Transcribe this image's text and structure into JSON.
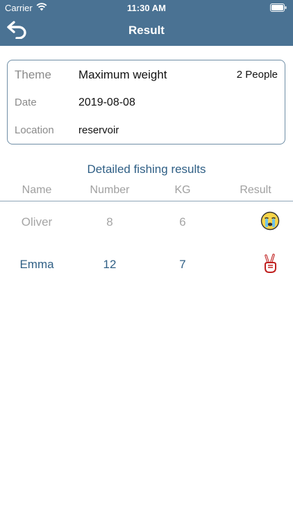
{
  "status_bar": {
    "carrier": "Carrier",
    "time": "11:30 AM"
  },
  "nav": {
    "title": "Result",
    "back_icon": "back-arrow-icon"
  },
  "info": {
    "theme_label": "Theme",
    "theme_value": "Maximum weight",
    "people": "2 People",
    "date_label": "Date",
    "date_value": "2019-08-08",
    "location_label": "Location",
    "location_value": "reservoir"
  },
  "section_title": "Detailed fishing results",
  "table": {
    "headers": [
      "Name",
      "Number",
      "KG",
      "Result"
    ],
    "rows": [
      {
        "name": "Oliver",
        "number": "8",
        "kg": "6",
        "result_icon": "crying-face-icon"
      },
      {
        "name": "Emma",
        "number": "12",
        "kg": "7",
        "result_icon": "victory-hand-icon"
      }
    ]
  },
  "colors": {
    "header_bg": "#4a7293",
    "accent": "#2f5f85",
    "muted": "#a5a5a5"
  }
}
